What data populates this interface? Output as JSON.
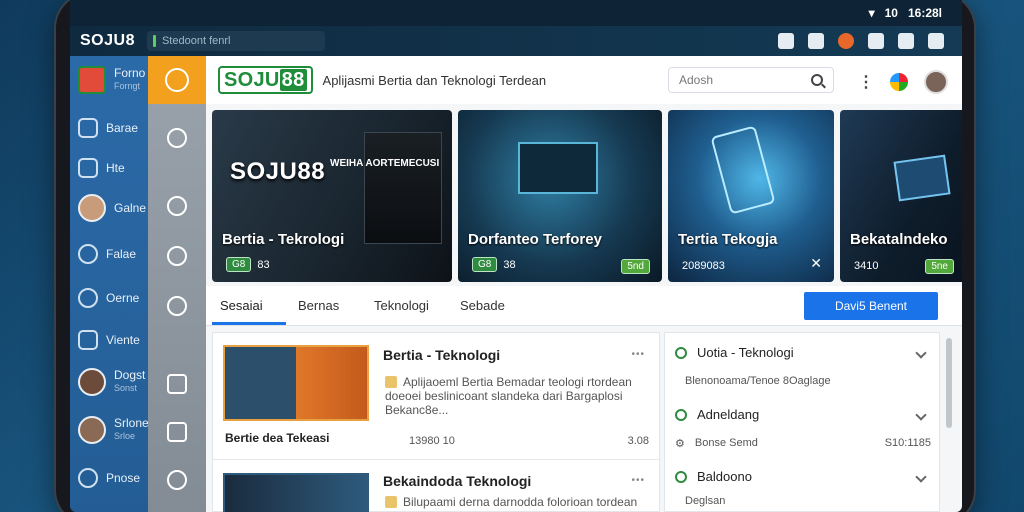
{
  "status": {
    "wifi_icon": "wifi-icon",
    "signal": "10",
    "time": "16:28l"
  },
  "appbar": {
    "title": "SOJU8",
    "address": "Stedoont fenrl"
  },
  "sidebar": {
    "items": [
      {
        "label": "Forno",
        "sub": "Forngt"
      },
      {
        "label": "Barae",
        "sub": ""
      },
      {
        "label": "Hte",
        "sub": ""
      },
      {
        "label": "Galne",
        "sub": ""
      },
      {
        "label": "Falae",
        "sub": ""
      },
      {
        "label": "Oerne",
        "sub": ""
      },
      {
        "label": "Viente",
        "sub": ""
      },
      {
        "label": "Dogst",
        "sub": "Sonst"
      },
      {
        "label": "Srlone",
        "sub": "Srloe"
      },
      {
        "label": "Pnose",
        "sub": ""
      }
    ]
  },
  "header": {
    "logo_a": "SOJU",
    "logo_b": "88",
    "tagline": "Aplijasmi Bertia dan Teknologi Terdean",
    "search_placeholder": "Adosh"
  },
  "cards": [
    {
      "big": "SOJU88",
      "small": "WEIHA AORTEMECUSI",
      "title": "Bertia - Tekrologi",
      "badge": "G8",
      "meta": "83"
    },
    {
      "title": "Dorfanteo Terforey",
      "badge": "G8",
      "meta": "38",
      "right_badge": "5nd"
    },
    {
      "title": "Tertia Tekogja",
      "meta": "2089083"
    },
    {
      "title": "Bekatalndeko",
      "meta": "3410",
      "right_badge": "5ne"
    }
  ],
  "tabs": [
    "Sesaiai",
    "Bernas",
    "Teknologi",
    "Sebade"
  ],
  "action_button": "Davi5 Benent",
  "news": [
    {
      "title": "Bertia - Teknologi",
      "desc": "Aplijaoeml Bertia Bemadar teologi rtordean doeoei beslinicoant slandeka dari Bargaplosi Bekanc8e...",
      "caption": "Bertie dea Tekeasi",
      "date": "13980 10",
      "count": "3.08",
      "dots": "•••"
    },
    {
      "title": "Bekaindoda Teknologi",
      "desc": "Bilupaami derna darnodda folorioan tordean",
      "dots": "•••"
    }
  ],
  "side": [
    {
      "label": "Uotia - Teknologi",
      "sub": "Blenonoama/Tenoe 8Oaglage",
      "sub_r": ""
    },
    {
      "label": "Adneldang",
      "sub": "Bonse Semd",
      "sub_r": "S10:1185"
    },
    {
      "label": "Baldoono",
      "sub": "Deglsan",
      "sub_r": ""
    }
  ]
}
